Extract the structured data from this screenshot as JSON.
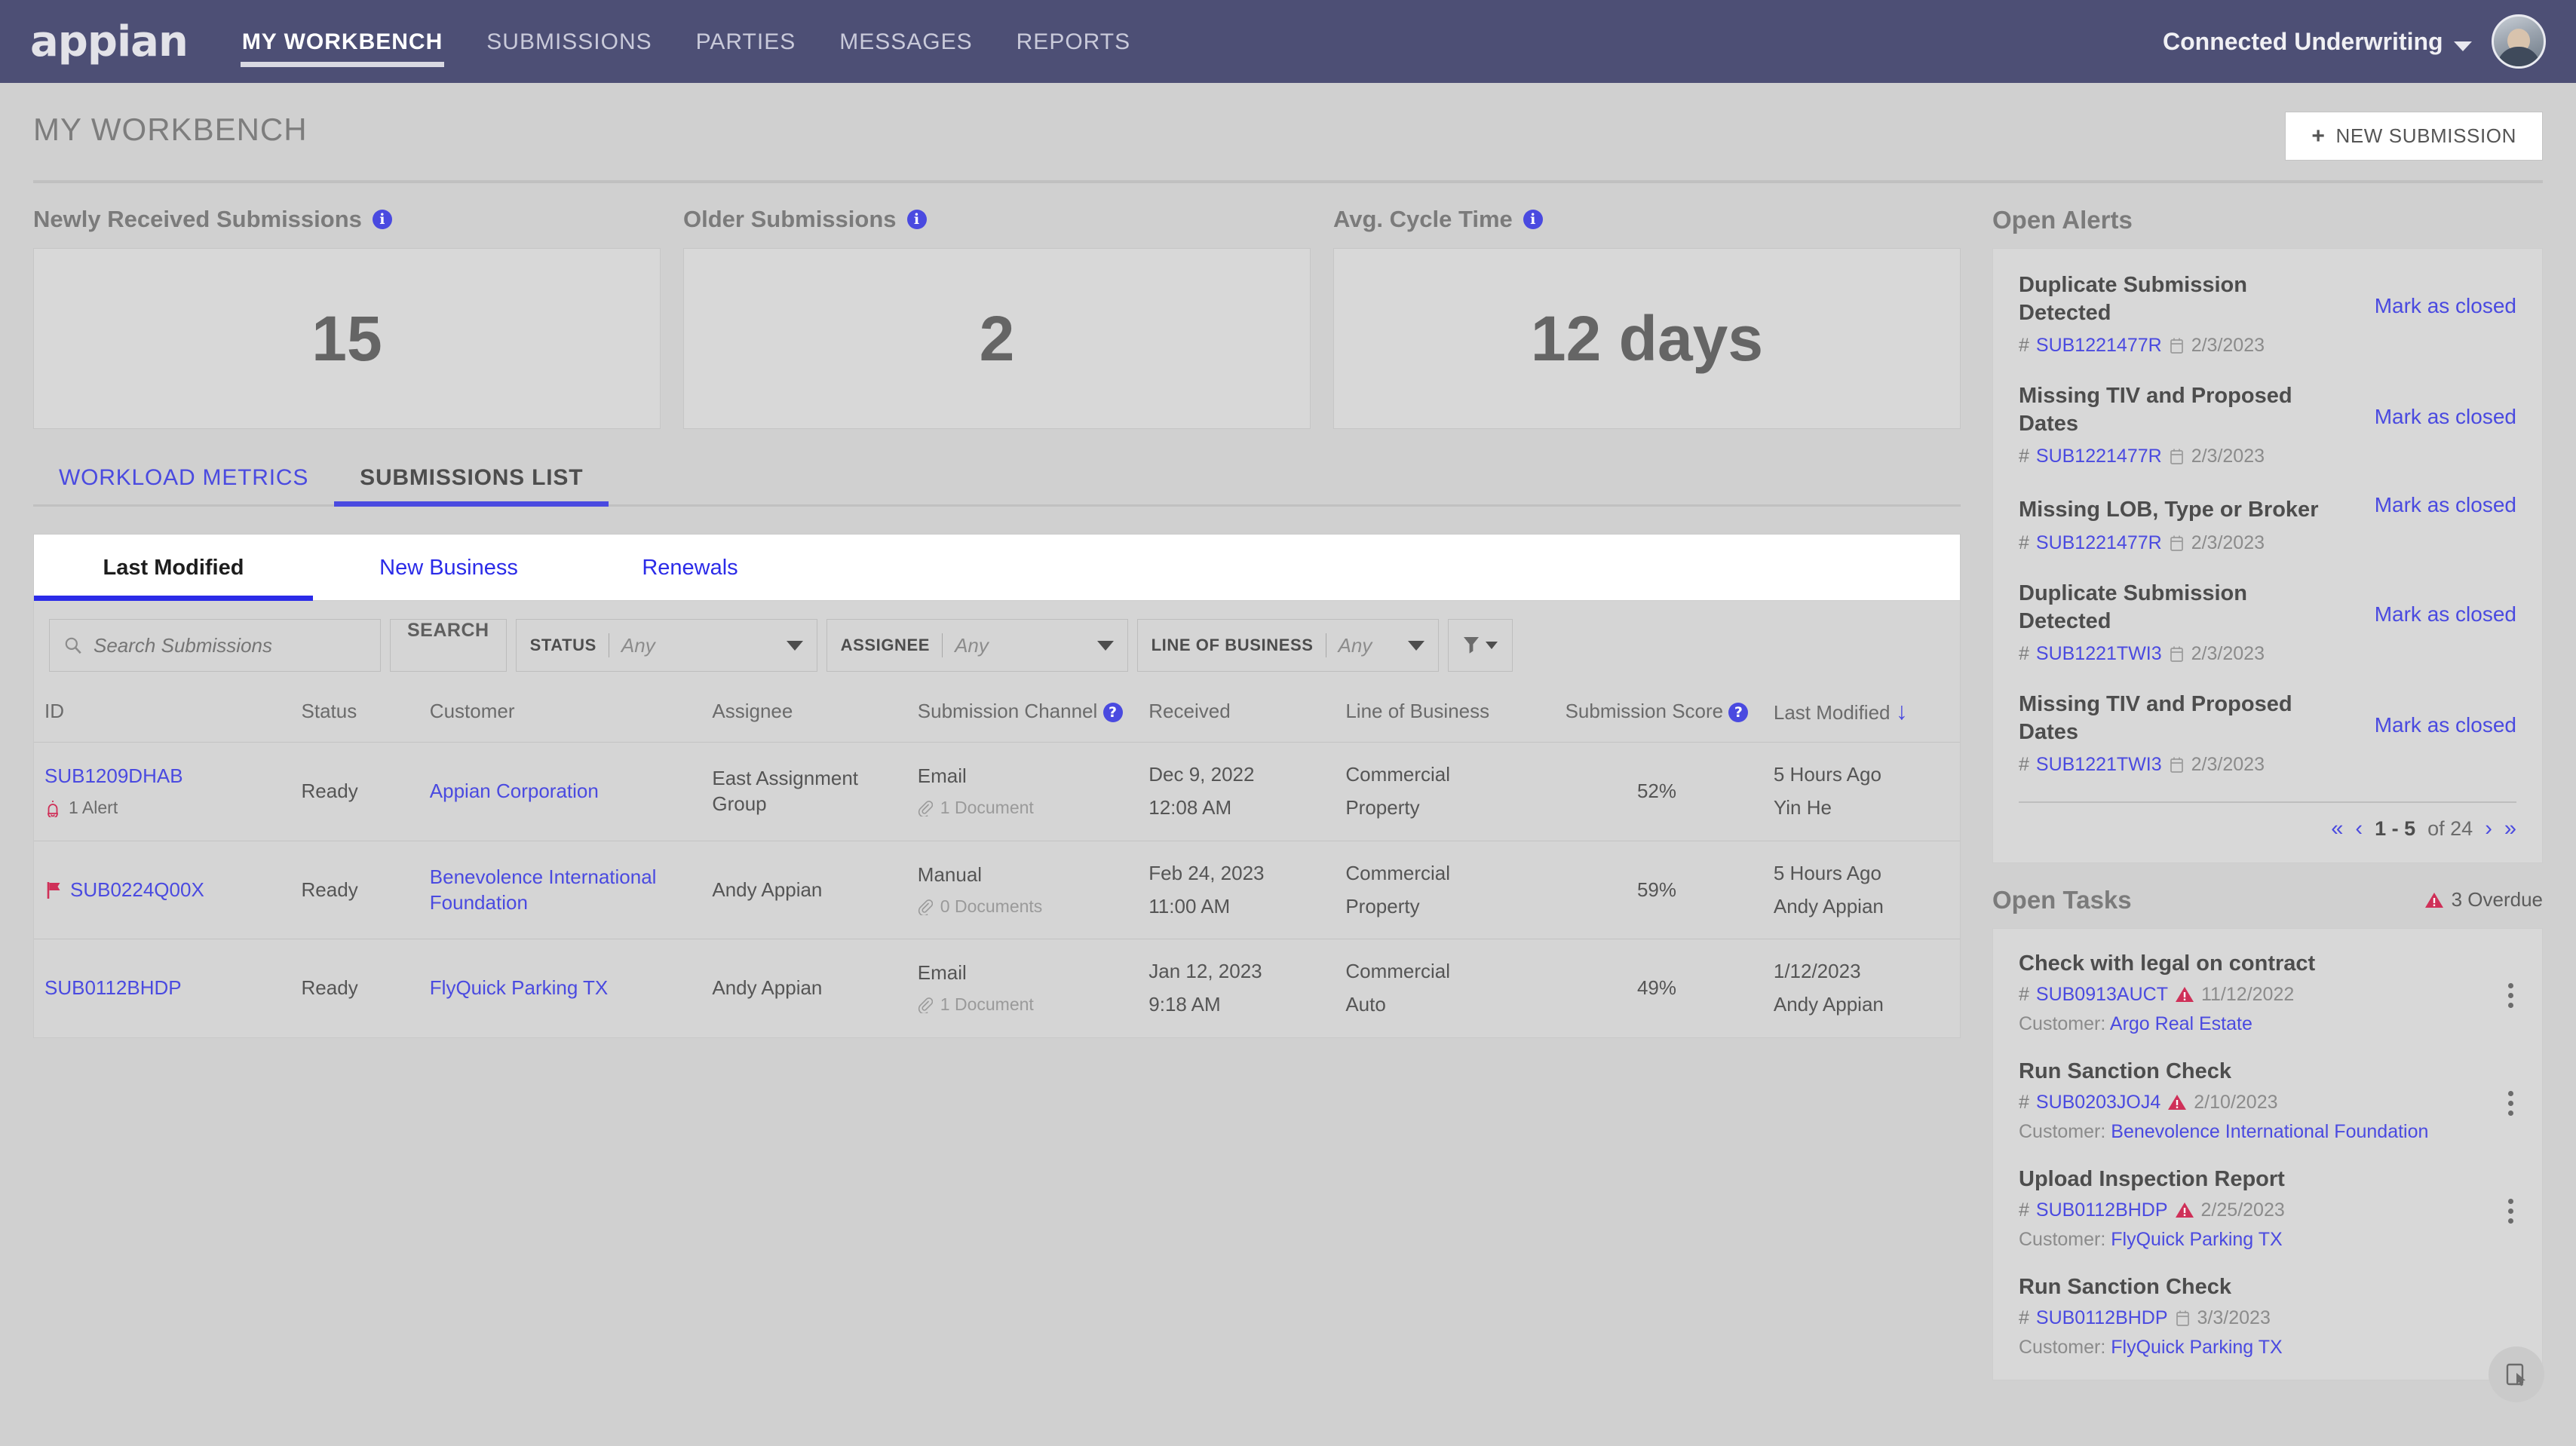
{
  "header": {
    "logo_text": "appian",
    "nav_items": [
      {
        "label": "MY WORKBENCH",
        "active": true
      },
      {
        "label": "SUBMISSIONS",
        "active": false
      },
      {
        "label": "PARTIES",
        "active": false
      },
      {
        "label": "MESSAGES",
        "active": false
      },
      {
        "label": "REPORTS",
        "active": false
      }
    ],
    "org_name": "Connected Underwriting"
  },
  "page": {
    "title": "MY WORKBENCH",
    "new_submission_label": "NEW SUBMISSION",
    "plus_glyph": "+"
  },
  "kpis": [
    {
      "label": "Newly Received Submissions",
      "value": "15"
    },
    {
      "label": "Older Submissions",
      "value": "2"
    },
    {
      "label": "Avg. Cycle Time",
      "value": "12 days"
    }
  ],
  "section_tabs": [
    {
      "label": "WORKLOAD METRICS",
      "active": false
    },
    {
      "label": "SUBMISSIONS LIST",
      "active": true
    }
  ],
  "sub_tabs": [
    {
      "label": "Last Modified",
      "active": true
    },
    {
      "label": "New Business",
      "active": false
    },
    {
      "label": "Renewals",
      "active": false
    }
  ],
  "filters": {
    "search_placeholder": "Search Submissions",
    "search_value": "",
    "search_button": "SEARCH",
    "status": {
      "label": "STATUS",
      "value": "Any"
    },
    "assignee": {
      "label": "ASSIGNEE",
      "value": "Any"
    },
    "line_of_business": {
      "label": "LINE OF BUSINESS",
      "value": "Any"
    }
  },
  "table": {
    "columns": {
      "id": "ID",
      "status": "Status",
      "customer": "Customer",
      "assignee": "Assignee",
      "channel": "Submission Channel",
      "received": "Received",
      "lob": "Line of Business",
      "score": "Submission Score",
      "modified": "Last Modified"
    },
    "sort_indicator": "↓",
    "rows": [
      {
        "id": "SUB1209DHAB",
        "flagged": false,
        "alert_text": "1 Alert",
        "status": "Ready",
        "customer": "Appian Corporation",
        "assignee": "East Assignment Group",
        "channel": "Email",
        "documents": "1 Document",
        "received_date": "Dec 9, 2022",
        "received_time": "12:08 AM",
        "lob_line1": "Commercial",
        "lob_line2": "Property",
        "score": "52%",
        "modified_when": "5 Hours Ago",
        "modified_by": "Yin He"
      },
      {
        "id": "SUB0224Q00X",
        "flagged": true,
        "alert_text": "",
        "status": "Ready",
        "customer": "Benevolence International Foundation",
        "assignee": "Andy Appian",
        "channel": "Manual",
        "documents": "0 Documents",
        "received_date": "Feb 24, 2023",
        "received_time": "11:00 AM",
        "lob_line1": "Commercial",
        "lob_line2": "Property",
        "score": "59%",
        "modified_when": "5 Hours Ago",
        "modified_by": "Andy Appian"
      },
      {
        "id": "SUB0112BHDP",
        "flagged": false,
        "alert_text": "",
        "status": "Ready",
        "customer": "FlyQuick Parking TX",
        "assignee": "Andy Appian",
        "channel": "Email",
        "documents": "1 Document",
        "received_date": "Jan 12, 2023",
        "received_time": "9:18 AM",
        "lob_line1": "Commercial",
        "lob_line2": "Auto",
        "score": "49%",
        "modified_when": "1/12/2023",
        "modified_by": "Andy Appian"
      }
    ]
  },
  "alerts_panel": {
    "title": "Open Alerts",
    "mark_closed_label": "Mark as closed",
    "items": [
      {
        "title": "Duplicate Submission Detected",
        "submission_id": "SUB1221477R",
        "date": "2/3/2023"
      },
      {
        "title": "Missing TIV and Proposed Dates",
        "submission_id": "SUB1221477R",
        "date": "2/3/2023"
      },
      {
        "title": "Missing LOB, Type or Broker",
        "submission_id": "SUB1221477R",
        "date": "2/3/2023"
      },
      {
        "title": "Duplicate Submission Detected",
        "submission_id": "SUB1221TWI3",
        "date": "2/3/2023"
      },
      {
        "title": "Missing TIV and Proposed Dates",
        "submission_id": "SUB1221TWI3",
        "date": "2/3/2023"
      }
    ],
    "pager": {
      "first": "«",
      "prev": "‹",
      "range": "1 - 5",
      "of": "of 24",
      "next": "›",
      "last": "»"
    }
  },
  "tasks_panel": {
    "title": "Open Tasks",
    "overdue_label": "3 Overdue",
    "customer_prefix": "Customer:",
    "items": [
      {
        "title": "Check with legal on contract",
        "submission_id": "SUB0913AUCT",
        "overdue": true,
        "date": "11/12/2022",
        "customer": "Argo Real Estate"
      },
      {
        "title": "Run Sanction Check",
        "submission_id": "SUB0203JOJ4",
        "overdue": true,
        "date": "2/10/2023",
        "customer": "Benevolence International Foundation"
      },
      {
        "title": "Upload Inspection Report",
        "submission_id": "SUB0112BHDP",
        "overdue": true,
        "date": "2/25/2023",
        "customer": "FlyQuick Parking TX"
      },
      {
        "title": "Run Sanction Check",
        "submission_id": "SUB0112BHDP",
        "overdue": false,
        "date": "3/3/2023",
        "customer": "FlyQuick Parking TX"
      }
    ]
  },
  "colors": {
    "header_bg": "#4d4f75",
    "accent_blue": "#4a4ae0",
    "page_bg": "#d0d0d0",
    "card_bg": "#d8d8d8",
    "alert_red": "#cf3058"
  }
}
